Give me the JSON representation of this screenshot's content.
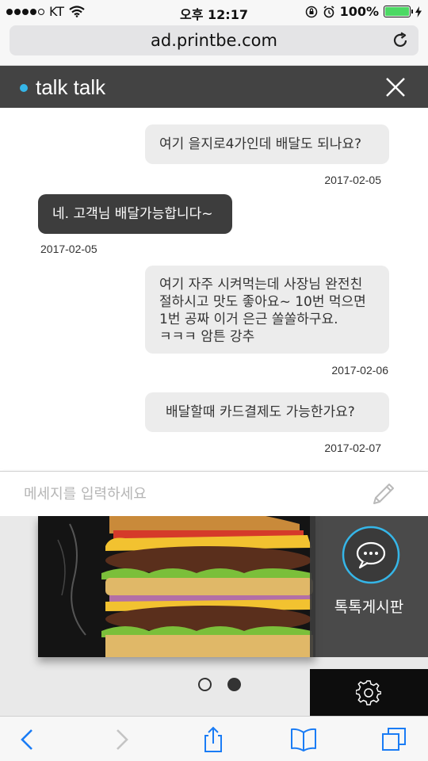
{
  "status": {
    "carrier": "KT",
    "time": "오후 12:17",
    "battery": "100%",
    "battery_level": 1.0
  },
  "browser": {
    "url": "ad.printbe.com"
  },
  "chat": {
    "title": "talk talk",
    "messages": [
      {
        "lines": [
          "여기 을지로4가인데 배달도 되나요?"
        ],
        "date": "2017-02-05"
      },
      {
        "lines": [
          "네. 고객님 배달가능합니다~"
        ],
        "date": "2017-02-05"
      },
      {
        "lines": [
          "여기 자주 시켜먹는데 사장님 완전친",
          "절하시고 맛도 좋아요~ 10번 먹으면",
          "1번 공짜 이거 은근 쏠쏠하구요.",
          "ㅋㅋㅋ 암튼 강추"
        ],
        "date": "2017-02-06"
      },
      {
        "lines": [
          "배달할때 카드결제도 가능한가요?"
        ],
        "date": "2017-02-07"
      }
    ],
    "input_placeholder": "메세지를 입력하세요"
  },
  "page": {
    "board_label": "톡톡게시판",
    "carousel_index": 2,
    "carousel_count": 2
  },
  "colors": {
    "accent": "#35b6e8",
    "header_bg": "#434343",
    "ios_blue": "#1a7cf5"
  }
}
